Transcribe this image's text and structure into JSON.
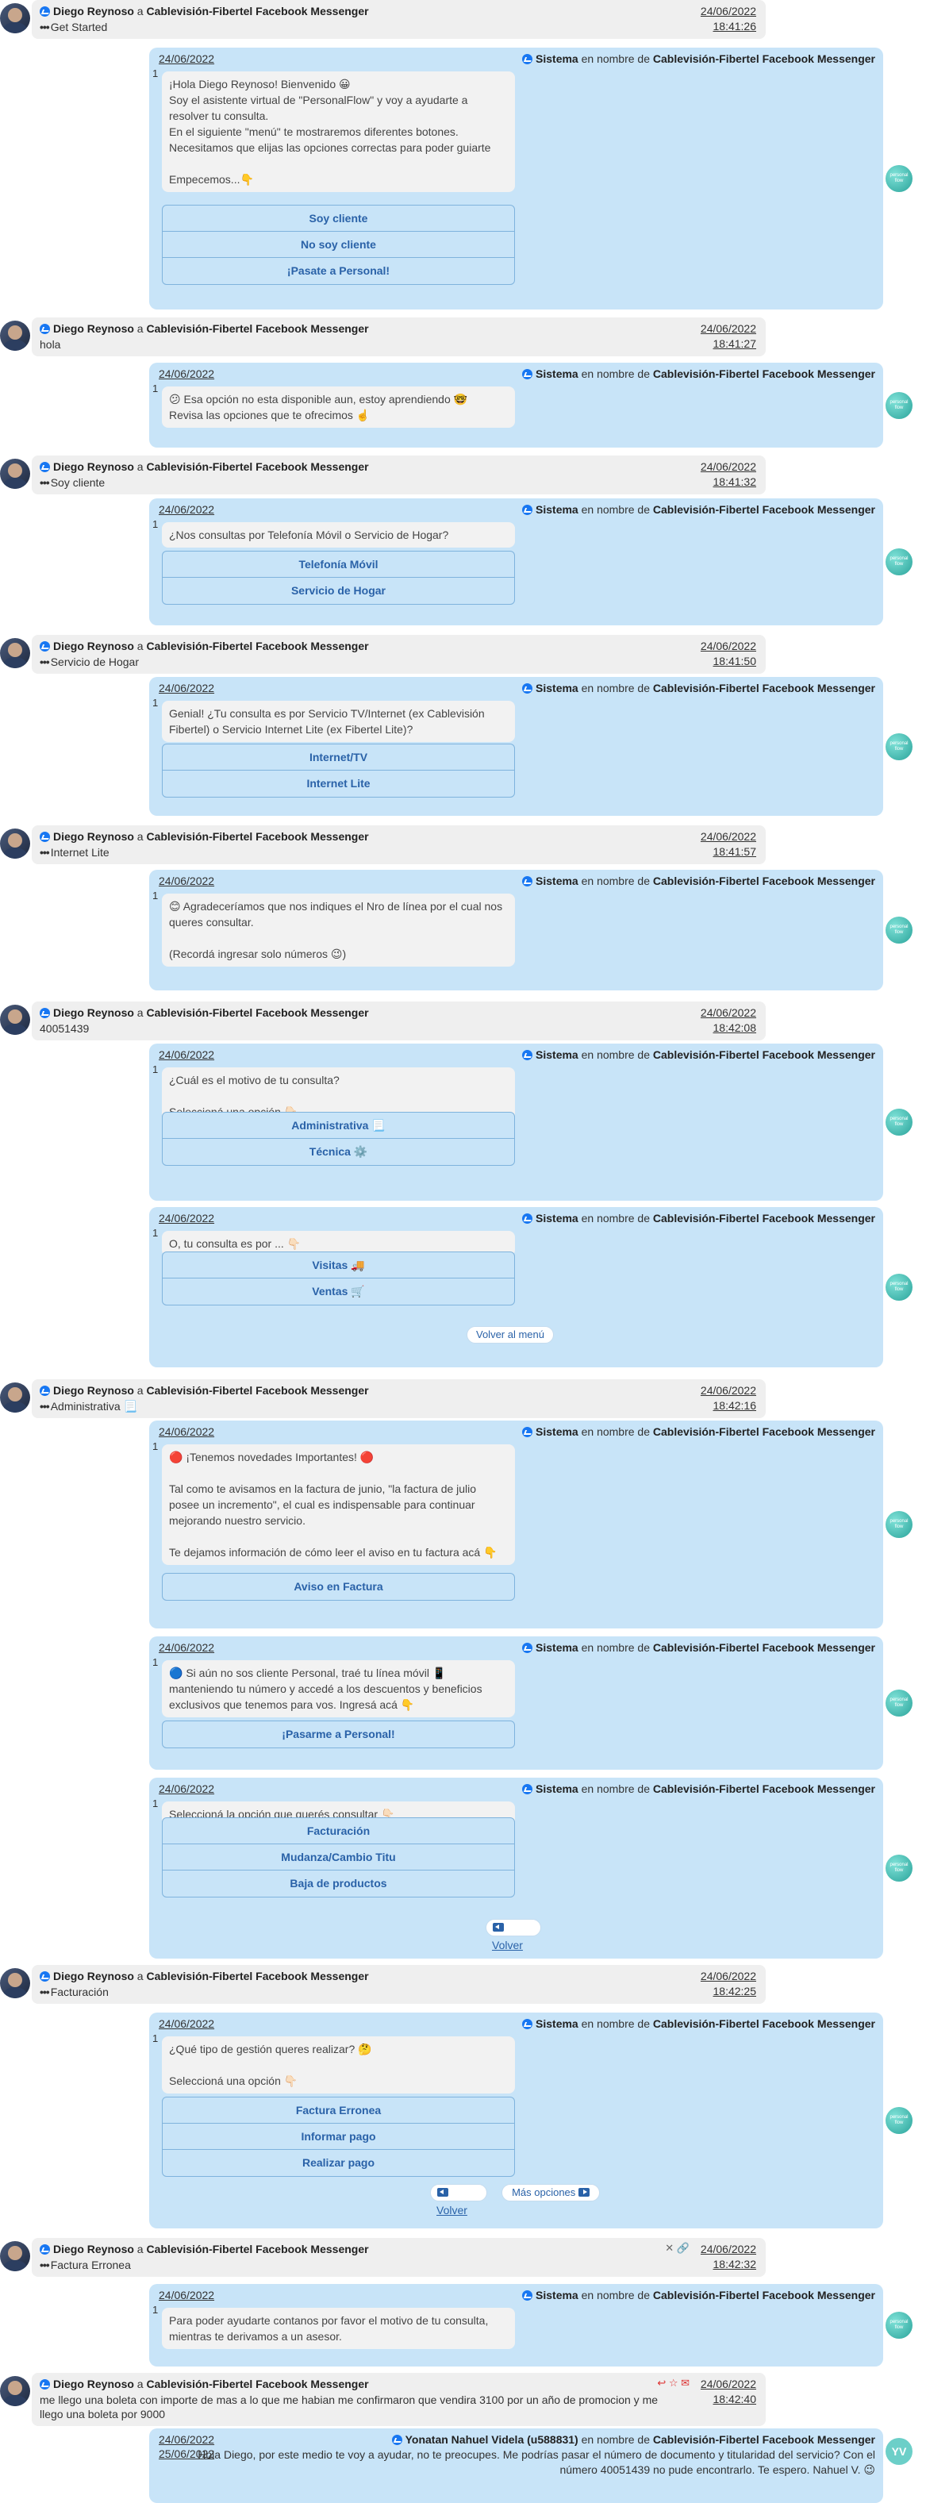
{
  "sender": "Diego Reynoso",
  "channel": "Cablevisión-Fibertel Facebook Messenger",
  "conn_a": "a",
  "conn_en": "en nombre de",
  "system": "Sistema",
  "bot_logo": "personal flow",
  "incoming": [
    {
      "date": "24/06/2022",
      "time": "18:41:26",
      "text": "Get Started",
      "dots": true
    },
    {
      "date": "24/06/2022",
      "time": "18:41:27",
      "text": "hola",
      "dots": false
    },
    {
      "date": "24/06/2022",
      "time": "18:41:32",
      "text": "Soy cliente",
      "dots": true
    },
    {
      "date": "24/06/2022",
      "time": "18:41:50",
      "text": "Servicio de Hogar",
      "dots": true
    },
    {
      "date": "24/06/2022",
      "time": "18:41:57",
      "text": "Internet Lite",
      "dots": true
    },
    {
      "date": "24/06/2022",
      "time": "18:42:08",
      "text": "40051439",
      "dots": false
    },
    {
      "date": "24/06/2022",
      "time": "18:42:16",
      "text": "Administrativa 📃",
      "dots": true
    },
    {
      "date": "24/06/2022",
      "time": "18:42:25",
      "text": "Facturación",
      "dots": true
    },
    {
      "date": "24/06/2022",
      "time": "18:42:32",
      "text": "Factura Erronea",
      "dots": true
    },
    {
      "date": "24/06/2022",
      "time": "18:42:40",
      "text": "me llego una boleta con importe de mas a lo que me habian me confirmaron que vendira 3100 por un año de promocion y me llego una boleta por 9000",
      "dots": false
    }
  ],
  "outgoing": [
    {
      "date": "24/06/2022",
      "text": "¡Hola Diego Reynoso! Bienvenido 😀\nSoy el asistente virtual de \"PersonalFlow\" y voy a ayudarte a resolver tu consulta.\nEn el siguiente \"menú\" te mostraremos diferentes botones. Necesitamos que elijas las opciones correctas para poder guiarte\n\nEmpecemos...👇",
      "buttons": [
        "Soy cliente",
        "No soy cliente",
        "¡Pasate a Personal!"
      ]
    },
    {
      "date": "24/06/2022",
      "text": "😕 Esa opción no esta disponible aun, estoy aprendiendo 🤓\nRevisa las opciones que te ofrecimos ☝️",
      "buttons": []
    },
    {
      "date": "24/06/2022",
      "text": "¿Nos consultas por Telefonía Móvil o Servicio de Hogar?",
      "buttons": [
        "Telefonía Móvil",
        "Servicio de Hogar"
      ]
    },
    {
      "date": "24/06/2022",
      "text": "Genial! ¿Tu consulta es por Servicio TV/Internet (ex Cablevisión Fibertel) o Servicio Internet Lite (ex Fibertel Lite)?",
      "buttons": [
        "Internet/TV",
        "Internet Lite"
      ]
    },
    {
      "date": "24/06/2022",
      "text": "😊 Agradeceríamos que nos indiques el Nro de línea por el cual nos queres consultar.\n\n(Recordá ingresar solo números 😉)",
      "buttons": []
    },
    {
      "date": "24/06/2022",
      "text": "¿Cuál es el motivo de tu consulta?\n\nSeleccioná una opción 👇🏻",
      "buttons": [
        "Administrativa 📃",
        "Técnica ⚙️"
      ]
    },
    {
      "date": "24/06/2022",
      "text": "O, tu consulta es por ... 👇🏻",
      "buttons": [
        "Visitas 🚚",
        "Ventas 🛒"
      ],
      "pill": "Volver al menú"
    },
    {
      "date": "24/06/2022",
      "text": "🔴 ¡Tenemos novedades Importantes! 🔴\n\nTal como te avisamos en la factura de junio, \"la factura de julio posee un incremento\", el cual es indispensable para continuar mejorando nuestro servicio.\n\nTe dejamos información de cómo leer el aviso en tu factura acá 👇",
      "buttons": [
        "Aviso en Factura"
      ]
    },
    {
      "date": "24/06/2022",
      "text": "🔵 Si aún no sos cliente Personal, traé tu línea móvil 📱 manteniendo tu número y accedé a los descuentos y beneficios exclusivos que tenemos para vos. Ingresá acá 👇",
      "buttons": [
        "¡Pasarme a Personal!"
      ]
    },
    {
      "date": "24/06/2022",
      "text": "Seleccioná la opción que querés consultar 👇🏻",
      "buttons": [
        "Facturación",
        "Mudanza/Cambio Titu",
        "Baja de productos"
      ],
      "back": "Volver"
    },
    {
      "date": "24/06/2022",
      "text": "¿Qué tipo de gestión queres realizar? 🤔\n\nSeleccioná una opción 👇🏻",
      "buttons": [
        "Factura Erronea",
        "Informar pago",
        "Realizar pago"
      ],
      "back": "Volver",
      "more": "Más opciones"
    },
    {
      "date": "24/06/2022",
      "text": "Para poder ayudarte contanos por favor el motivo de tu consulta, mientras te derivamos a un asesor.",
      "buttons": []
    }
  ],
  "agent": {
    "date": "24/06/2022",
    "name": "Yonatan Nahuel Videla (u588831)",
    "initials": "YV",
    "text": "Hola Diego, por este medio te voy a ayudar, no te preocupes. Me podrías pasar el número de documento y titularidad del servicio? Con el número 40051439 no pude encontrarlo. Te espero. Nahuel V. 😉",
    "overlap": "25/06/2022"
  }
}
